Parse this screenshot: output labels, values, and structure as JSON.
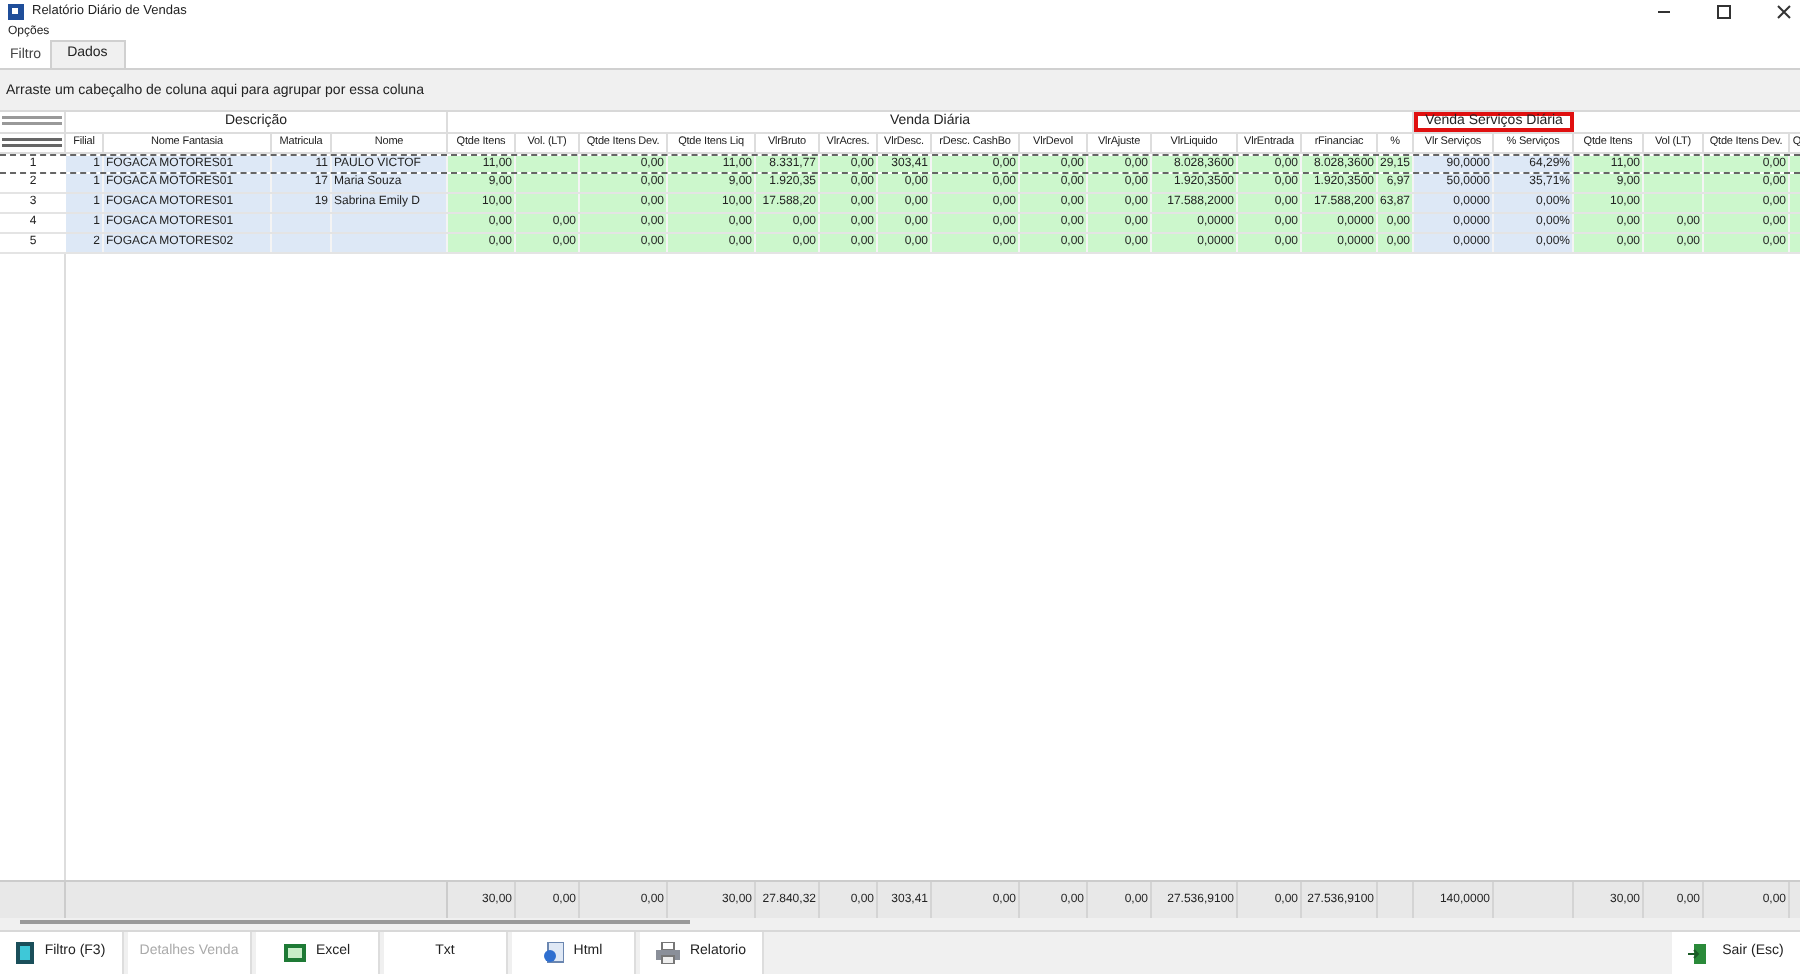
{
  "window": {
    "title": "Relatório Diário de Vendas"
  },
  "menu": [
    "Opções"
  ],
  "tabs": [
    {
      "label": "Filtro",
      "selected": false
    },
    {
      "label": "Dados",
      "selected": true
    }
  ],
  "group_panel": "Arraste um cabeçalho de coluna aqui para agrupar por essa coluna",
  "grid": {
    "bands": [
      {
        "title": "Descrição",
        "color": "#dde8f6",
        "highlighted": false,
        "columns": [
          {
            "label": "Filial",
            "kind": "number"
          },
          {
            "label": "Nome Fantasia",
            "kind": "text"
          },
          {
            "label": "Matricula",
            "kind": "number"
          },
          {
            "label": "Nome",
            "kind": "text"
          }
        ]
      },
      {
        "title": "Venda Diária",
        "color": "#ccf7cc",
        "highlighted": false,
        "columns": [
          {
            "label": "Qtde Itens",
            "kind": "number",
            "total": "30,00"
          },
          {
            "label": "Vol. (LT)",
            "kind": "number",
            "total": "0,00"
          },
          {
            "label": "Qtde Itens Dev.",
            "kind": "number",
            "total": "0,00"
          },
          {
            "label": "Qtde Itens Liq",
            "kind": "number",
            "total": "30,00"
          },
          {
            "label": "VlrBruto",
            "kind": "number",
            "total": "27.840,32"
          },
          {
            "label": "VlrAcres.",
            "kind": "number",
            "total": "0,00"
          },
          {
            "label": "VlrDesc.",
            "kind": "number",
            "total": "303,41"
          },
          {
            "label": "rDesc. CashBo",
            "kind": "number",
            "total": "0,00"
          },
          {
            "label": "VlrDevol",
            "kind": "number",
            "total": "0,00"
          },
          {
            "label": "VlrAjuste",
            "kind": "number",
            "total": "0,00"
          },
          {
            "label": "VlrLiquido",
            "kind": "number",
            "total": "27.536,9100"
          },
          {
            "label": "VlrEntrada",
            "kind": "number",
            "total": "0,00"
          },
          {
            "label": "rFinanciac",
            "kind": "number",
            "total": "27.536,9100"
          },
          {
            "label": "%",
            "kind": "number"
          }
        ]
      },
      {
        "title": "Venda Serviços Diária",
        "color": "#dde8f6",
        "highlighted": true,
        "columns": [
          {
            "label": "Vlr Serviços",
            "kind": "number",
            "total": "140,0000"
          },
          {
            "label": "% Serviços",
            "kind": "number"
          }
        ]
      },
      {
        "color": "#ccf7cc",
        "columns": [
          {
            "label": "Qtde Itens",
            "kind": "number",
            "total": "30,00"
          },
          {
            "label": "Vol (LT)",
            "kind": "number",
            "total": "0,00"
          },
          {
            "label": "Qtde Itens Dev.",
            "kind": "number",
            "total": "0,00"
          },
          {
            "label": "Q",
            "kind": "number"
          }
        ]
      }
    ],
    "rows": [
      {
        "number": "1",
        "selected": true,
        "cells": [
          "1",
          "FOGACA MOTORES01",
          "11",
          "PAULO VICTOF",
          "11,00",
          null,
          "0,00",
          "11,00",
          "8.331,77",
          "0,00",
          "303,41",
          "0,00",
          "0,00",
          "0,00",
          "8.028,3600",
          "0,00",
          "8.028,3600",
          "29,15",
          "90,0000",
          "64,29%",
          "11,00",
          null,
          "0,00",
          null
        ]
      },
      {
        "number": "2",
        "selected": false,
        "cells": [
          "1",
          "FOGACA MOTORES01",
          "17",
          "Maria Souza",
          "9,00",
          null,
          "0,00",
          "9,00",
          "1.920,35",
          "0,00",
          "0,00",
          "0,00",
          "0,00",
          "0,00",
          "1.920,3500",
          "0,00",
          "1.920,3500",
          "6,97",
          "50,0000",
          "35,71%",
          "9,00",
          null,
          "0,00",
          null
        ]
      },
      {
        "number": "3",
        "selected": false,
        "cells": [
          "1",
          "FOGACA MOTORES01",
          "19",
          "Sabrina Emily D",
          "10,00",
          null,
          "0,00",
          "10,00",
          "17.588,20",
          "0,00",
          "0,00",
          "0,00",
          "0,00",
          "0,00",
          "17.588,2000",
          "0,00",
          "17.588,200",
          "63,87",
          "0,0000",
          "0,00%",
          "10,00",
          null,
          "0,00",
          null
        ]
      },
      {
        "number": "4",
        "selected": false,
        "cells": [
          "1",
          "FOGACA MOTORES01",
          null,
          null,
          "0,00",
          "0,00",
          "0,00",
          "0,00",
          "0,00",
          "0,00",
          "0,00",
          "0,00",
          "0,00",
          "0,00",
          "0,0000",
          "0,00",
          "0,0000",
          "0,00",
          "0,0000",
          "0,00%",
          "0,00",
          "0,00",
          "0,00",
          null
        ]
      },
      {
        "number": "5",
        "selected": false,
        "cells": [
          "2",
          "FOGACA MOTORES02",
          null,
          null,
          "0,00",
          "0,00",
          "0,00",
          "0,00",
          "0,00",
          "0,00",
          "0,00",
          "0,00",
          "0,00",
          "0,00",
          "0,0000",
          "0,00",
          "0,0000",
          "0,00",
          "0,0000",
          "0,00%",
          "0,00",
          "0,00",
          "0,00",
          null
        ]
      }
    ]
  },
  "buttons": [
    {
      "label": "Filtro (F3)",
      "disabled": false
    },
    {
      "label": "Detalhes Venda",
      "disabled": true
    },
    {
      "label": "Excel",
      "disabled": false
    },
    {
      "label": "Txt",
      "disabled": false
    },
    {
      "label": "Html",
      "disabled": false
    },
    {
      "label": "Relatorio",
      "disabled": false
    }
  ],
  "exit_button": {
    "label": "Sair (Esc)"
  }
}
